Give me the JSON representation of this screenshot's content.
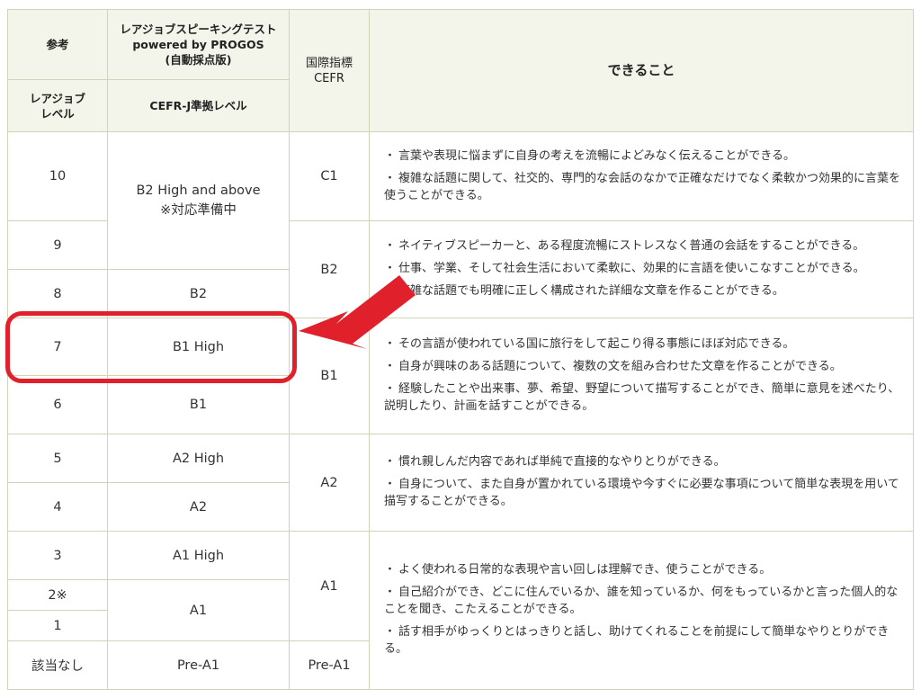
{
  "header": {
    "ref": "参考",
    "test_title": "レアジョブスピーキングテスト\npowered by PROGOS\n(自動採点版)",
    "cefr_title": "国際指標\nCEFR",
    "can_do_title": "できること",
    "rarejob_level": "レアジョブ\nレベル",
    "cefrj_level": "CEFR-J準拠レベル"
  },
  "rows": [
    {
      "level": "10"
    },
    {
      "level": "9"
    },
    {
      "level": "8",
      "cefrj": "B2"
    },
    {
      "level": "7",
      "cefrj": "B1 High"
    },
    {
      "level": "6",
      "cefrj": "B1"
    },
    {
      "level": "5",
      "cefrj": "A2 High"
    },
    {
      "level": "4",
      "cefrj": "A2"
    },
    {
      "level": "3",
      "cefrj": "A1 High"
    },
    {
      "level": "2※"
    },
    {
      "level": "1"
    },
    {
      "level": "該当なし",
      "cefrj": "Pre-A1",
      "cefr": "Pre-A1"
    }
  ],
  "merged": {
    "b2_high": "B2 High and above\n※対応準備中",
    "a1": "A1"
  },
  "cefr": {
    "c1": "C1",
    "b2": "B2",
    "b1": "B1",
    "a2": "A2",
    "a1": "A1"
  },
  "descriptions": {
    "c1": [
      "言葉や表現に悩まずに自身の考えを流暢によどみなく伝えることができる。",
      "複雑な話題に関して、社交的、専門的な会話のなかで正確なだけでなく柔軟かつ効果的に言葉を使うことができる。"
    ],
    "b2": [
      "ネイティブスピーカーと、ある程度流暢にストレスなく普通の会話をすることができる。",
      "仕事、学業、そして社会生活において柔軟に、効果的に言語を使いこなすことができる。",
      "複雑な話題でも明確に正しく構成された詳細な文章を作ることができる。"
    ],
    "b1": [
      "その言語が使われている国に旅行をして起こり得る事態にほぼ対応できる。",
      "自身が興味のある話題について、複数の文を組み合わせた文章を作ることができる。",
      "経験したことや出来事、夢、希望、野望について描写することができ、簡単に意見を述べたり、説明したり、計画を話すことができる。"
    ],
    "a2": [
      "慣れ親しんだ内容であれば単純で直接的なやりとりができる。",
      "自身について、また自身が置かれている環境や今すぐに必要な事項について簡単な表現を用いて描写することができる。"
    ],
    "a1": [
      "よく使われる日常的な表現や言い回しは理解でき、使うことができる。",
      "自己紹介ができ、どこに住んでいるか、誰を知っているか、何をもっているかと言った個人的なことを聞き、こたえることができる。",
      "話す相手がゆっくりとはっきりと話し、助けてくれることを前提にして簡単なやりとりができる。"
    ]
  },
  "bullet": "・",
  "colors": {
    "highlight": "#e0202a",
    "header_bg": "#f4f5ea",
    "border": "#cfd6b8"
  }
}
